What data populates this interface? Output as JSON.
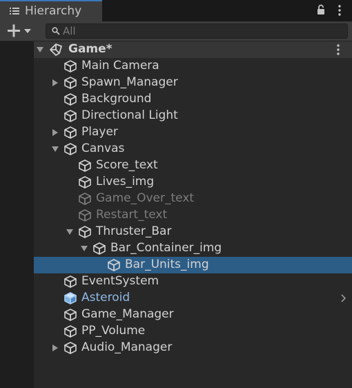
{
  "window": {
    "tab_title": "Hierarchy"
  },
  "toolbar": {
    "search_placeholder": "All"
  },
  "scene": {
    "name": "Game*"
  },
  "items": [
    {
      "label": "Main Camera",
      "depth": 0,
      "expander": "none",
      "state": "normal"
    },
    {
      "label": "Spawn_Manager",
      "depth": 0,
      "expander": "collapsed",
      "state": "normal"
    },
    {
      "label": "Background",
      "depth": 0,
      "expander": "none",
      "state": "normal"
    },
    {
      "label": "Directional Light",
      "depth": 0,
      "expander": "none",
      "state": "normal"
    },
    {
      "label": "Player",
      "depth": 0,
      "expander": "collapsed",
      "state": "normal"
    },
    {
      "label": "Canvas",
      "depth": 0,
      "expander": "expanded",
      "state": "normal"
    },
    {
      "label": "Score_text",
      "depth": 1,
      "expander": "none",
      "state": "normal"
    },
    {
      "label": "Lives_img",
      "depth": 1,
      "expander": "none",
      "state": "normal"
    },
    {
      "label": "Game_Over_text",
      "depth": 1,
      "expander": "none",
      "state": "inactive"
    },
    {
      "label": "Restart_text",
      "depth": 1,
      "expander": "none",
      "state": "inactive"
    },
    {
      "label": "Thruster_Bar",
      "depth": 1,
      "expander": "expanded",
      "state": "normal"
    },
    {
      "label": "Bar_Container_img",
      "depth": 2,
      "expander": "expanded",
      "state": "normal"
    },
    {
      "label": "Bar_Units_img",
      "depth": 3,
      "expander": "none",
      "state": "selected"
    },
    {
      "label": "EventSystem",
      "depth": 0,
      "expander": "none",
      "state": "normal"
    },
    {
      "label": "Asteroid",
      "depth": 0,
      "expander": "none",
      "state": "prefab"
    },
    {
      "label": "Game_Manager",
      "depth": 0,
      "expander": "none",
      "state": "normal"
    },
    {
      "label": "PP_Volume",
      "depth": 0,
      "expander": "none",
      "state": "normal"
    },
    {
      "label": "Audio_Manager",
      "depth": 0,
      "expander": "collapsed",
      "state": "normal"
    }
  ],
  "colors": {
    "selection": "#2c5d87",
    "prefab_text": "#8fb9e6",
    "inactive_text": "#7c7c7c",
    "text": "#d2d2d2",
    "tab_accent": "#3a79bb"
  },
  "icons": {
    "tab": "list-icon",
    "lock": "lock-icon",
    "menu": "kebab-menu-icon",
    "add": "plus-icon",
    "search": "search-icon",
    "scene": "unity-logo-icon",
    "object": "cube-icon",
    "prefab": "prefab-cube-icon"
  }
}
